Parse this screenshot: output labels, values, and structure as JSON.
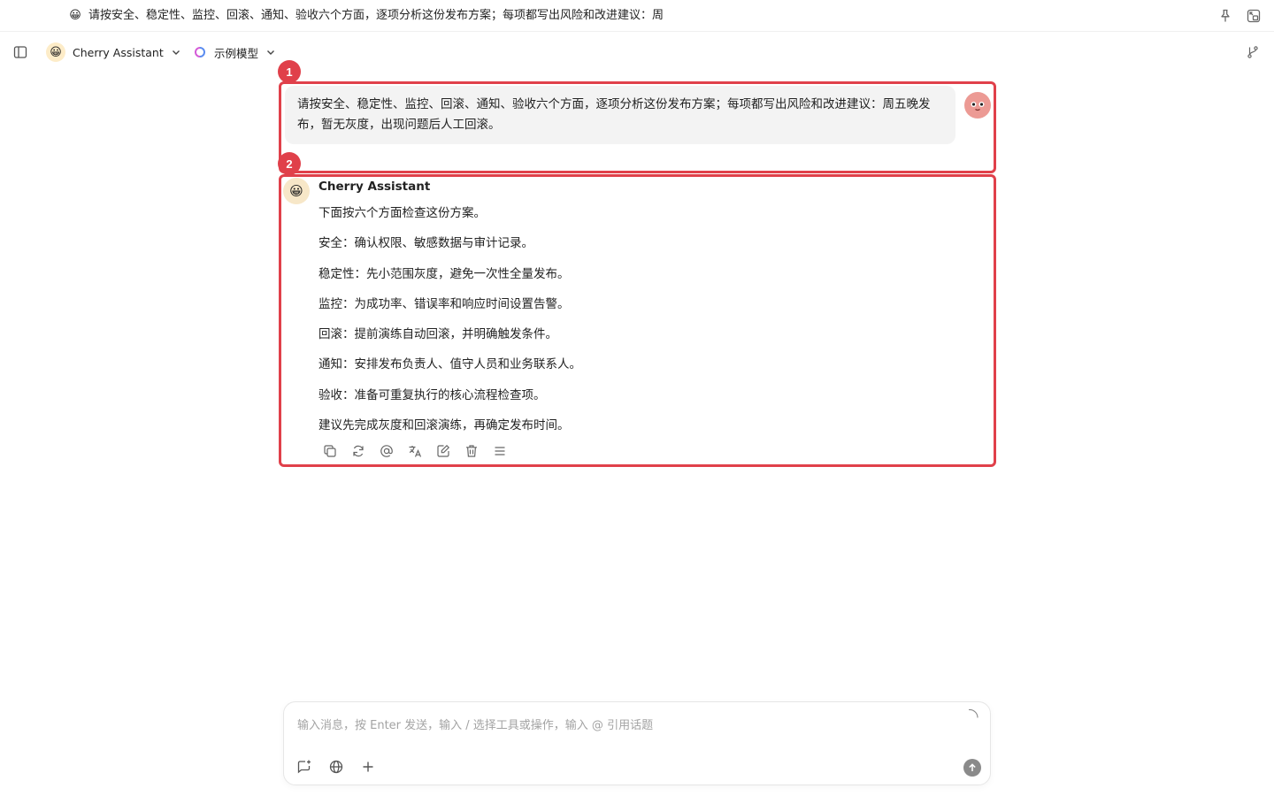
{
  "titlebar": {
    "emoji": "😀",
    "topic_title": "请按安全、稳定性、监控、回滚、通知、验收六个方面，逐项分析这份发布方案；每项都写出风险和改进建议：周",
    "icons": [
      "pin-icon",
      "mini-window-icon"
    ]
  },
  "navbar": {
    "assistant_emoji": "😀",
    "assistant_name": "Cherry Assistant",
    "model_name": "示例模型",
    "icons": [
      "sidebar-toggle-icon",
      "chevron-down-icon",
      "model-logo-icon",
      "branch-icon"
    ]
  },
  "badges": [
    "1",
    "2"
  ],
  "user_message": {
    "text": "请按安全、稳定性、监控、回滚、通知、验收六个方面，逐项分析这份发布方案；每项都写出风险和改进建议：周五晚发布，暂无灰度，出现问题后人工回滚。"
  },
  "assistant_message": {
    "emoji": "😀",
    "name": "Cherry Assistant",
    "paragraphs": [
      "下面按六个方面检查这份方案。",
      "安全：确认权限、敏感数据与审计记录。",
      "稳定性：先小范围灰度，避免一次性全量发布。",
      "监控：为成功率、错误率和响应时间设置告警。",
      "回滚：提前演练自动回滚，并明确触发条件。",
      "通知：安排发布负责人、值守人员和业务联系人。",
      "验收：准备可重复执行的核心流程检查项。",
      "建议先完成灰度和回滚演练，再确定发布时间。"
    ],
    "actions": [
      "copy-icon",
      "regenerate-icon",
      "mention-icon",
      "translate-icon",
      "edit-icon",
      "delete-icon",
      "menu-icon"
    ]
  },
  "composer": {
    "placeholder": "输入消息，按 Enter 发送，输入 / 选择工具或操作，输入 @ 引用话题",
    "tools": [
      "new-topic-icon",
      "web-search-icon",
      "add-icon",
      "send-icon"
    ]
  },
  "colors": {
    "highlight": "#e0404a",
    "user_bubble": "#f3f3f3",
    "send_button": "#8a8a8a"
  }
}
